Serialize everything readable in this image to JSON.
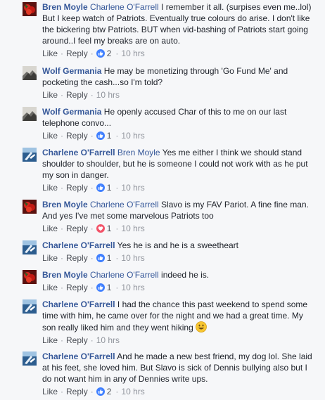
{
  "comments": [
    {
      "author": "Bren Moyle",
      "tag": "Charlene O'Farrell",
      "text": " I remember it all. (surpises even me..lol) But I keep watch of Patriots. Eventually true colours do arise. I don't like the bickering btw Patriots. BUT when vid-bashing of Patriots start going around..I feel my breaks are on auto.",
      "like": "Like",
      "reply": "Reply",
      "reaction": "like",
      "count": "2",
      "time": "10 hrs"
    },
    {
      "author": "Wolf Germania",
      "tag": "",
      "text": " He may be monetizing through 'Go Fund Me' and pocketing the cash...so I'm told?",
      "like": "Like",
      "reply": "Reply",
      "reaction": "",
      "count": "",
      "time": "10 hrs"
    },
    {
      "author": "Wolf Germania",
      "tag": "",
      "text": " He openly accused Char of this to me on our last telephone convo...",
      "like": "Like",
      "reply": "Reply",
      "reaction": "like",
      "count": "1",
      "time": "10 hrs"
    },
    {
      "author": "Charlene O'Farrell",
      "tag": "Bren Moyle",
      "text": " Yes me either I think we should stand shoulder to shoulder, but he is someone I could not work with as he put my son in danger.",
      "like": "Like",
      "reply": "Reply",
      "reaction": "like",
      "count": "1",
      "time": "10 hrs"
    },
    {
      "author": "Bren Moyle",
      "tag": "Charlene O'Farrell",
      "text": " Slavo is my FAV Pariot. A fine fine man. And yes I've met some marvelous Patriots too",
      "like": "Like",
      "reply": "Reply",
      "reaction": "love",
      "count": "1",
      "time": "10 hrs"
    },
    {
      "author": "Charlene O'Farrell",
      "tag": "",
      "text": " Yes he is and he is a sweetheart",
      "like": "Like",
      "reply": "Reply",
      "reaction": "like",
      "count": "1",
      "time": "10 hrs"
    },
    {
      "author": "Bren Moyle",
      "tag": "Charlene O'Farrell",
      "text": " indeed he is.",
      "like": "Like",
      "reply": "Reply",
      "reaction": "like",
      "count": "1",
      "time": "10 hrs"
    },
    {
      "author": "Charlene O'Farrell",
      "tag": "",
      "text": " I had the chance this past weekend to spend some time with him, he came over for the night and we had a great time. My son really liked him and they went hiking",
      "like": "Like",
      "reply": "Reply",
      "reaction": "",
      "count": "",
      "time": "10 hrs",
      "emoji": "smile-emoji"
    },
    {
      "author": "Charlene O'Farrell",
      "tag": "",
      "text": " And he made a new best friend, my dog lol. She laid at his feet, she loved him. But Slavo is sick of Dennis bullying also but I do not want him in any of Dennies write ups.",
      "like": "Like",
      "reply": "Reply",
      "reaction": "like",
      "count": "2",
      "time": "10 hrs"
    }
  ],
  "colors": {
    "link": "#365899",
    "meta": "#90949c",
    "like_blue": "#4080ff",
    "love_red": "#f25268"
  }
}
